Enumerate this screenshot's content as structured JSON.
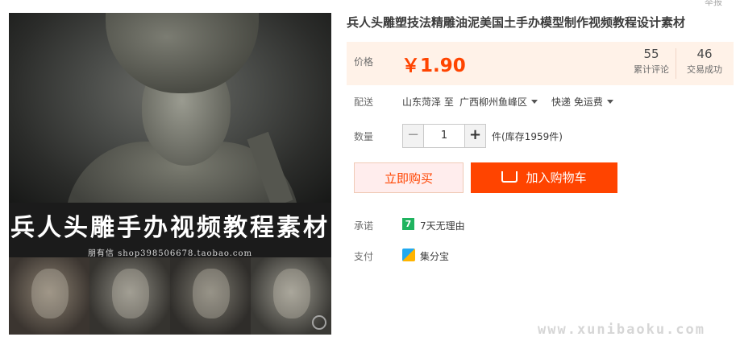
{
  "image": {
    "banner_title": "兵人头雕手办视频教程素材",
    "banner_sub": "朋有信 shop398506678.taobao.com"
  },
  "header": {
    "corner_text": "举报"
  },
  "product": {
    "title": "兵人头雕塑技法精雕油泥美国土手办模型制作视频教程设计素材"
  },
  "price": {
    "label": "价格",
    "value": "￥1.90",
    "stats": [
      {
        "num": "55",
        "caption": "累计评论"
      },
      {
        "num": "46",
        "caption": "交易成功"
      }
    ]
  },
  "shipping": {
    "label": "配送",
    "from": "山东菏泽 至",
    "to": "广西柳州鱼峰区",
    "method": "快递 免运费"
  },
  "quantity": {
    "label": "数量",
    "minus": "−",
    "value": "1",
    "plus": "+",
    "stock_text": "件(库存1959件)"
  },
  "actions": {
    "buy_now": "立即购买",
    "add_cart": "加入购物车"
  },
  "promise": {
    "label": "承诺",
    "icon_char": "7",
    "text": "7天无理由"
  },
  "payment": {
    "label": "支付",
    "text": "集分宝"
  },
  "watermark": "www.xunibaoku.com"
}
